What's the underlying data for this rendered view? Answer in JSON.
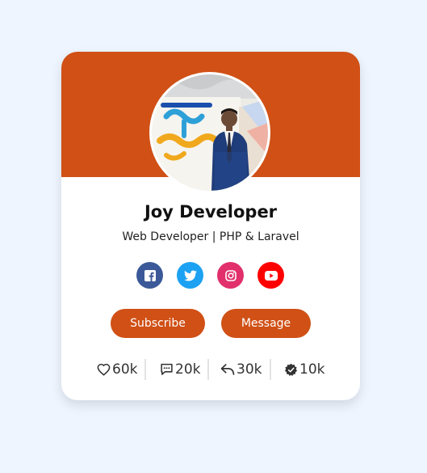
{
  "profile": {
    "name": "Joy Developer",
    "role": "Web Developer | PHP & Laravel",
    "photo_alt": "profile photo"
  },
  "colors": {
    "accent": "#d05016",
    "page_background": "#eef5ff",
    "facebook": "#3b5998",
    "twitter": "#1da1f2",
    "instagram": "#e1306c",
    "youtube": "#ff0000"
  },
  "socials": [
    {
      "icon": "facebook-icon"
    },
    {
      "icon": "twitter-icon"
    },
    {
      "icon": "instagram-icon"
    },
    {
      "icon": "youtube-icon"
    }
  ],
  "actions": {
    "subscribe_label": "Subscribe",
    "message_label": "Message"
  },
  "stats": [
    {
      "icon": "heart-icon",
      "value": "60k"
    },
    {
      "icon": "comment-icon",
      "value": "20k"
    },
    {
      "icon": "share-icon",
      "value": "30k"
    },
    {
      "icon": "verified-badge-icon",
      "value": "10k"
    }
  ]
}
